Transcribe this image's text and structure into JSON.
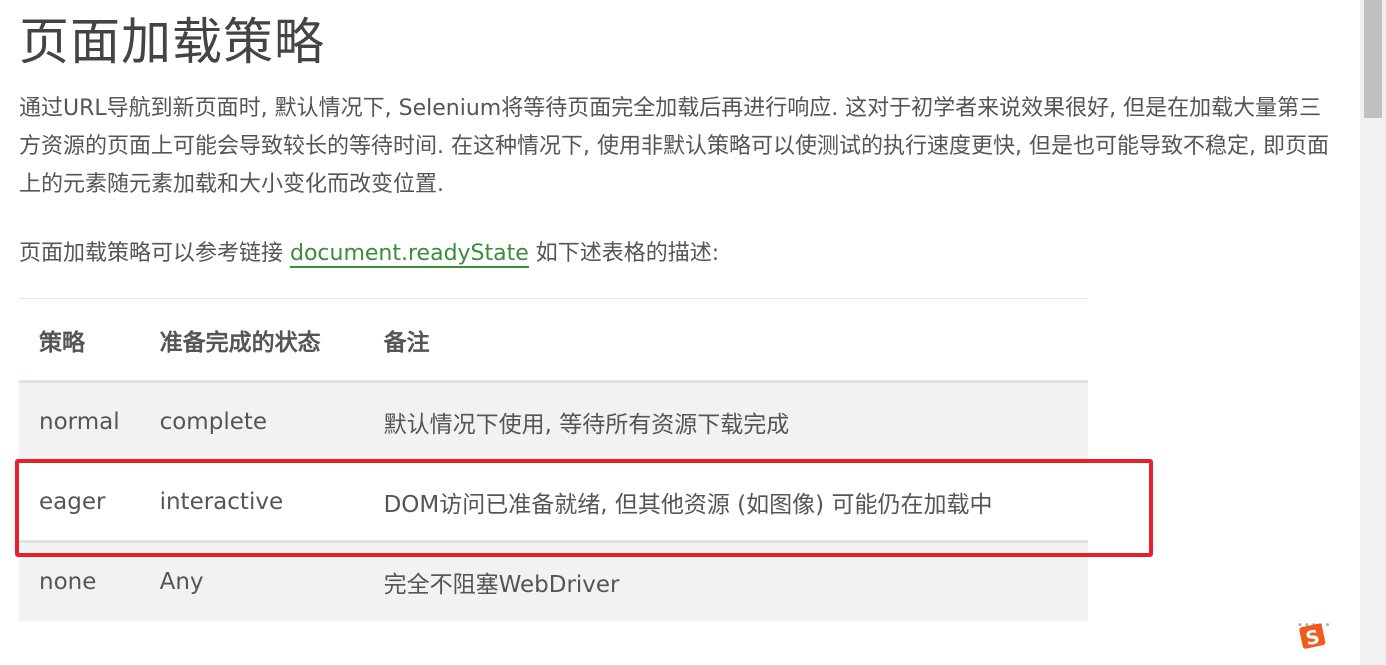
{
  "page": {
    "title": "页面加载策略",
    "paragraph1": "通过URL导航到新页面时, 默认情况下, Selenium将等待页面完全加载后再进行响应. 这对于初学者来说效果很好, 但是在加载大量第三方资源的页面上可能会导致较长的等待时间. 在这种情况下, 使用非默认策略可以使测试的执行速度更快, 但是也可能导致不稳定, 即页面上的元素随元素加载和大小变化而改变位置.",
    "paragraph2_prefix": "页面加载策略可以参考链接 ",
    "paragraph2_link": "document.readyState",
    "paragraph2_suffix": " 如下述表格的描述:"
  },
  "table": {
    "headers": [
      "策略",
      "准备完成的状态",
      "备注"
    ],
    "rows": [
      [
        "normal",
        "complete",
        "默认情况下使用, 等待所有资源下载完成"
      ],
      [
        "eager",
        "interactive",
        "DOM访问已准备就绪, 但其他资源 (如图像) 可能仍在加载中"
      ],
      [
        "none",
        "Any",
        "完全不阻塞WebDriver"
      ]
    ],
    "highlighted_row": "eager"
  },
  "colors": {
    "link": "#3a8e3a",
    "highlight_box": "#e8202a",
    "row_alt": "#f2f2f2"
  },
  "icons": {
    "ime": "sogou-input-icon"
  }
}
